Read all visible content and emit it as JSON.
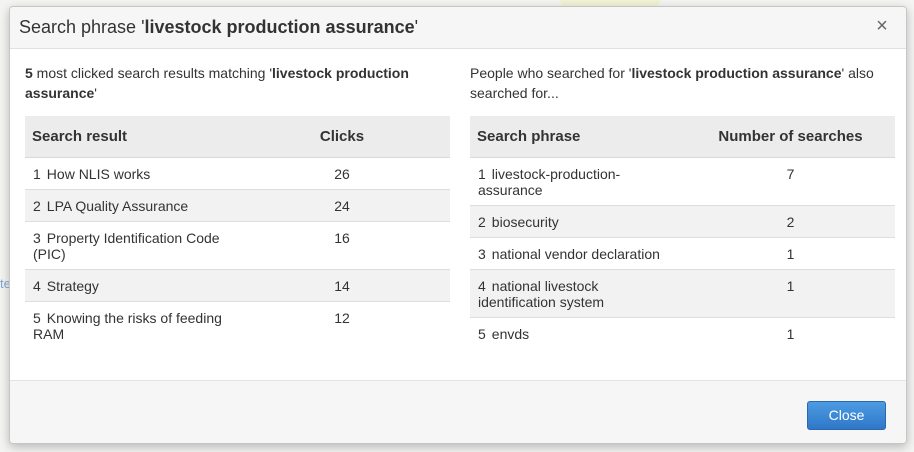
{
  "header": {
    "title_prefix": "Search phrase '",
    "title_phrase": "livestock production assurance",
    "title_suffix": "'",
    "close_glyph": "×"
  },
  "left": {
    "intro_count": "5",
    "intro_middle": " most clicked search results matching '",
    "intro_phrase": "livestock production assurance",
    "intro_end": "'",
    "columns": [
      "Search result",
      "Clicks"
    ],
    "rows": [
      {
        "rank": "1",
        "label": "How NLIS works",
        "value": "26"
      },
      {
        "rank": "2",
        "label": "LPA Quality Assurance",
        "value": "24"
      },
      {
        "rank": "3",
        "label": "Property Identification Code (PIC)",
        "value": "16"
      },
      {
        "rank": "4",
        "label": "Strategy",
        "value": "14"
      },
      {
        "rank": "5",
        "label": "Knowing the risks of feeding RAM",
        "value": "12"
      }
    ]
  },
  "right": {
    "intro_start": "People who searched for '",
    "intro_phrase": "livestock production assurance",
    "intro_end": "' also searched for...",
    "columns": [
      "Search phrase",
      "Number of searches"
    ],
    "rows": [
      {
        "rank": "1",
        "label": "livestock-production-assurance",
        "value": "7"
      },
      {
        "rank": "2",
        "label": "biosecurity",
        "value": "2"
      },
      {
        "rank": "3",
        "label": "national vendor declaration",
        "value": "1"
      },
      {
        "rank": "4",
        "label": "national livestock identification system",
        "value": "1"
      },
      {
        "rank": "5",
        "label": "envds",
        "value": "1"
      }
    ]
  },
  "footer": {
    "close_label": "Close"
  },
  "colors": {
    "primary_button": "#2f78c9",
    "header_bg": "#f6f6f6",
    "table_header_bg": "#ececec"
  }
}
